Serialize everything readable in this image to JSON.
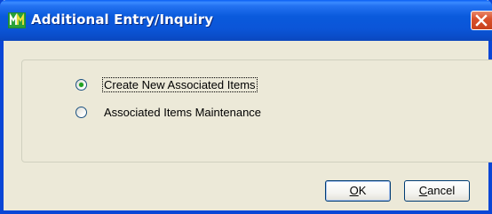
{
  "window": {
    "title": "Additional Entry/Inquiry",
    "icon": "mas90-app-icon",
    "close_icon": "close-icon"
  },
  "options": [
    {
      "label": "Create New Associated Items",
      "selected": true,
      "focused": true
    },
    {
      "label": "Associated Items Maintenance",
      "selected": false,
      "focused": false
    }
  ],
  "buttons": {
    "ok": {
      "mnemonic": "O",
      "rest": "K"
    },
    "cancel": {
      "mnemonic": "C",
      "rest": "ancel"
    }
  },
  "colors": {
    "titlebar": "#0a5adc",
    "dialog_bg": "#ece9d8",
    "close_button": "#d9512c",
    "radio_dot": "#21a121"
  }
}
